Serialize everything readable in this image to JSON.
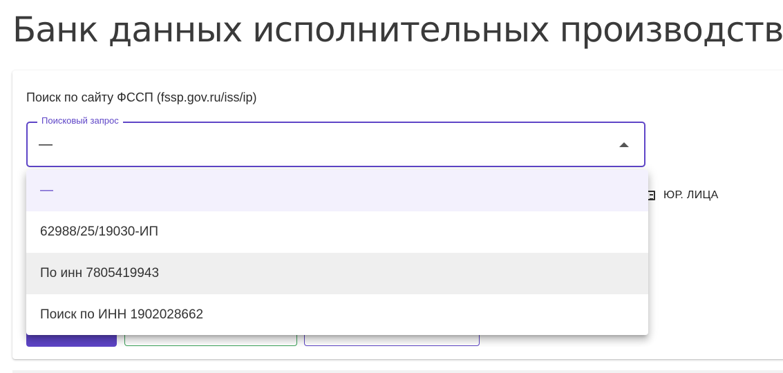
{
  "page": {
    "title": "Банк данных исполнительных производств"
  },
  "search": {
    "subtitle": "Поиск по сайту ФССП (fssp.gov.ru/iss/ip)",
    "label": "Поисковый запрос",
    "value": "—"
  },
  "tabs": {
    "legal_label": "ЮР. ЛИЦА"
  },
  "dropdown": {
    "options": [
      {
        "label": "—",
        "selected": true
      },
      {
        "label": "62988/25/19030-ИП"
      },
      {
        "label": "По инн 7805419943",
        "hovered": true
      },
      {
        "label": "Поиск по ИНН 1902028662"
      }
    ]
  },
  "colors": {
    "accent": "#5e45c7",
    "green": "#3da35a"
  },
  "icons": {
    "legal": "document-icon",
    "dropdown": "arrow-up-icon"
  }
}
